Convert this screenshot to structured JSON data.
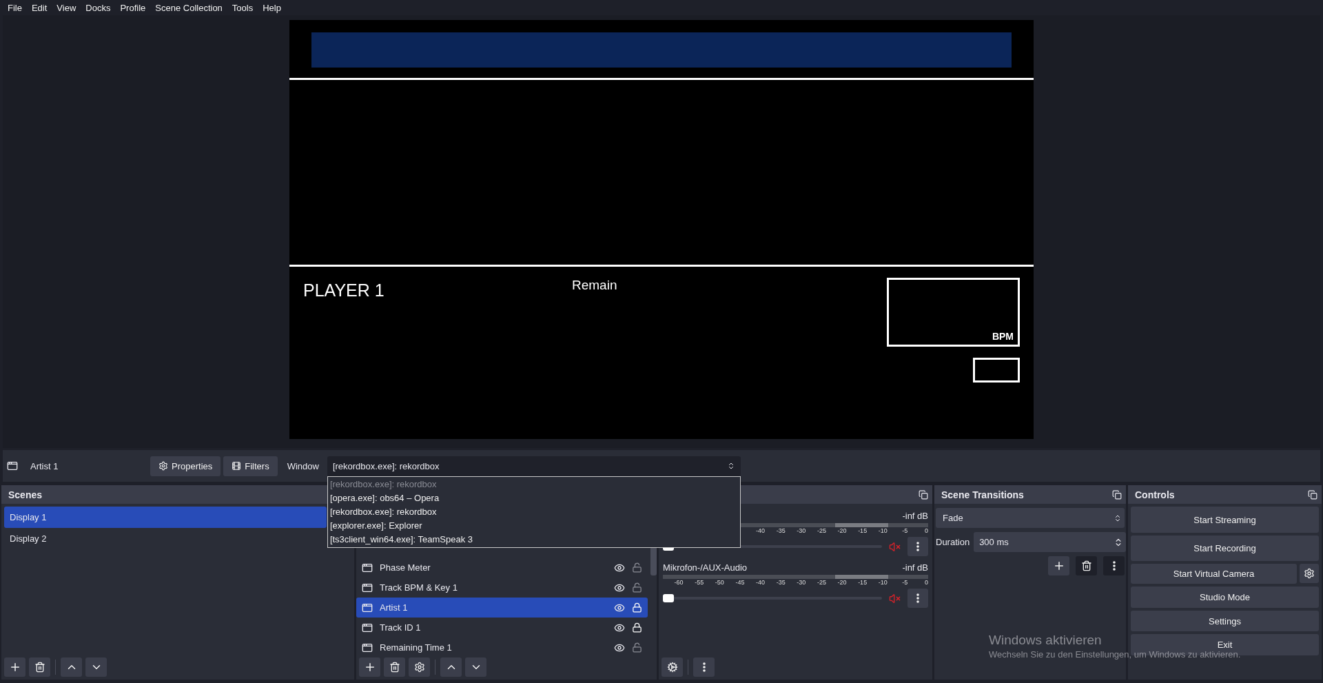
{
  "menu": [
    "File",
    "Edit",
    "View",
    "Docks",
    "Profile",
    "Scene Collection",
    "Tools",
    "Help"
  ],
  "preview": {
    "player": "PLAYER 1",
    "remain": "Remain",
    "bpm": "BPM"
  },
  "source_toolbar": {
    "source_name": "Artist 1",
    "buttons": [
      {
        "kind": "properties",
        "label": "Properties"
      },
      {
        "kind": "filters",
        "label": "Filters"
      }
    ],
    "window_label": "Window",
    "window_value": "[rekordbox.exe]: rekordbox",
    "options": [
      {
        "label": "[rekordbox.exe]: rekordbox",
        "disabled": true
      },
      {
        "label": "[opera.exe]: obs64 – Opera",
        "disabled": false
      },
      {
        "label": "[rekordbox.exe]: rekordbox",
        "disabled": false
      },
      {
        "label": "[explorer.exe]: Explorer",
        "disabled": false
      },
      {
        "label": "[ts3client_win64.exe]: TeamSpeak 3",
        "disabled": false
      }
    ]
  },
  "scenes": {
    "title": "Scenes",
    "items": [
      {
        "label": "Display 1",
        "selected": true
      },
      {
        "label": "Display 2",
        "selected": false
      }
    ]
  },
  "sources": {
    "items": [
      {
        "label": "Phase Meter",
        "selected": false,
        "visible": true,
        "locked": false
      },
      {
        "label": "Track BPM & Key 1",
        "selected": false,
        "visible": true,
        "locked": false
      },
      {
        "label": "Artist 1",
        "selected": true,
        "visible": true,
        "locked": true
      },
      {
        "label": "Track ID 1",
        "selected": false,
        "visible": true,
        "locked": true
      },
      {
        "label": "Remaining Time 1",
        "selected": false,
        "visible": true,
        "locked": false
      }
    ]
  },
  "audio_mixer": {
    "channels": [
      {
        "reading": "-inf dB",
        "muted": true,
        "level": 0,
        "ticks": [
          "-40",
          "-35",
          "-30",
          "-25",
          "-20",
          "-15",
          "-10",
          "-5",
          "0"
        ]
      },
      {
        "name": "Mikrofon-/AUX-Audio",
        "reading": "-inf dB",
        "muted": true,
        "level": 0,
        "ticks": [
          "-60",
          "-55",
          "-50",
          "-45",
          "-40",
          "-35",
          "-30",
          "-25",
          "-20",
          "-15",
          "-10",
          "-5",
          "0"
        ]
      }
    ]
  },
  "scene_transitions": {
    "title": "Scene Transitions",
    "transition": "Fade",
    "duration_label": "Duration",
    "duration": "300 ms"
  },
  "controls": {
    "title": "Controls",
    "buttons": [
      "Start Streaming",
      "Start Recording",
      "Start Virtual Camera",
      "Studio Mode",
      "Settings",
      "Exit"
    ]
  },
  "activation_notice": {
    "title": "Windows aktivieren",
    "subtitle": "Wechseln Sie zu den Einstellungen, um Windows zu aktivieren."
  }
}
